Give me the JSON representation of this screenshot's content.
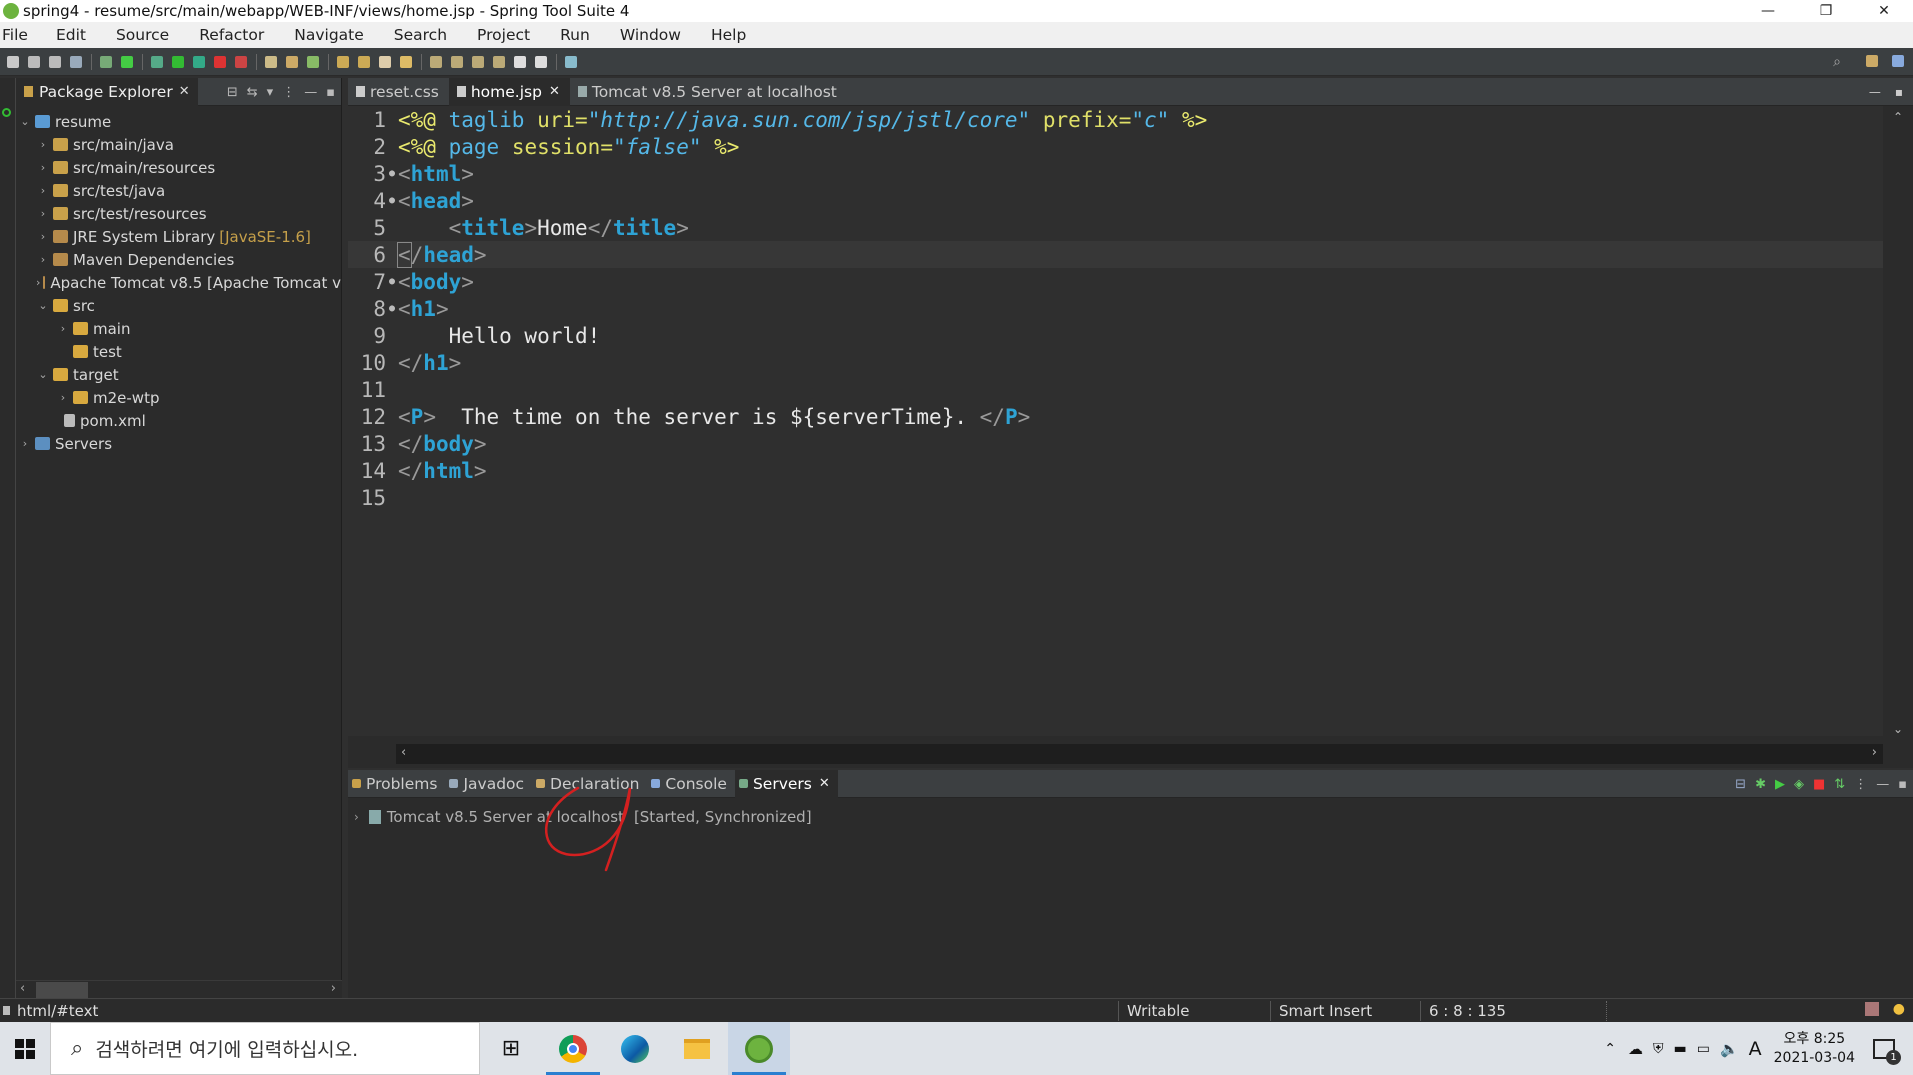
{
  "window": {
    "title": "spring4 - resume/src/main/webapp/WEB-INF/views/home.jsp - Spring Tool Suite 4",
    "minimize_glyph": "—",
    "restore_glyph": "❐",
    "close_glyph": "✕"
  },
  "menu": [
    "File",
    "Edit",
    "Source",
    "Refactor",
    "Navigate",
    "Search",
    "Project",
    "Run",
    "Window",
    "Help"
  ],
  "package_explorer": {
    "title": "Package Explorer",
    "tree": [
      {
        "label": "resume",
        "icon": "project-icon",
        "expanded": true
      },
      {
        "label": "src/main/java",
        "icon": "package-folder-icon"
      },
      {
        "label": "src/main/resources",
        "icon": "package-folder-icon"
      },
      {
        "label": "src/test/java",
        "icon": "package-folder-icon"
      },
      {
        "label": "src/test/resources",
        "icon": "package-folder-icon"
      },
      {
        "label": "JRE System Library",
        "decoration": "[JavaSE-1.6]",
        "icon": "library-icon"
      },
      {
        "label": "Maven Dependencies",
        "icon": "library-icon"
      },
      {
        "label": "Apache Tomcat v8.5 [Apache Tomcat v",
        "icon": "library-icon"
      },
      {
        "label": "src",
        "icon": "folder-icon",
        "expanded": true
      },
      {
        "label": "main",
        "icon": "folder-icon"
      },
      {
        "label": "test",
        "icon": "folder-icon"
      },
      {
        "label": "target",
        "icon": "folder-icon",
        "expanded": true
      },
      {
        "label": "m2e-wtp",
        "icon": "folder-icon"
      },
      {
        "label": "pom.xml",
        "icon": "file-icon"
      },
      {
        "label": "Servers",
        "icon": "server-folder-icon"
      }
    ]
  },
  "editor": {
    "tabs": [
      {
        "label": "reset.css",
        "active": false
      },
      {
        "label": "home.jsp",
        "active": true
      },
      {
        "label": "Tomcat v8.5 Server at localhost",
        "active": false
      }
    ],
    "current_line": 6,
    "lines": [
      {
        "n": "1"
      },
      {
        "n": "2"
      },
      {
        "n": "3"
      },
      {
        "n": "4"
      },
      {
        "n": "5"
      },
      {
        "n": "6"
      },
      {
        "n": "7"
      },
      {
        "n": "8"
      },
      {
        "n": "9"
      },
      {
        "n": "10"
      },
      {
        "n": "11"
      },
      {
        "n": "12"
      },
      {
        "n": "13"
      },
      {
        "n": "14"
      },
      {
        "n": "15"
      }
    ],
    "code": {
      "l1_open": "<%@",
      "l1_dir": "taglib",
      "l1_attr1": "uri=",
      "l1_val1": "\"http://java.sun.com/jsp/jstl/core\"",
      "l1_attr2": "prefix=",
      "l1_val2": "\"c\"",
      "l1_close": "%>",
      "l2_open": "<%@",
      "l2_dir": "page",
      "l2_attr": "session=",
      "l2_val": "\"false\"",
      "l2_close": "%>",
      "tag_html": "html",
      "tag_head": "head",
      "tag_title": "title",
      "title_text": "Home",
      "tag_body": "body",
      "tag_h1": "h1",
      "h1_text": "Hello world!",
      "tag_p": "P",
      "p_text": "The time on the server is ${serverTime}. "
    }
  },
  "bottom_panel": {
    "tabs": [
      {
        "label": "Problems",
        "active": false
      },
      {
        "label": "Javadoc",
        "active": false
      },
      {
        "label": "Declaration",
        "active": false
      },
      {
        "label": "Console",
        "active": false
      },
      {
        "label": "Servers",
        "active": true
      }
    ],
    "server": {
      "name": "Tomcat v8.5 Server at localhost",
      "state": "[Started, Synchronized]"
    }
  },
  "status_bar": {
    "path": "html/#text",
    "writable": "Writable",
    "insert_mode": "Smart Insert",
    "position": "6 : 8 : 135"
  },
  "taskbar": {
    "search_placeholder": "검색하려면 여기에 입력하십시오.",
    "ime": "A",
    "clock_time": "오후 8:25",
    "clock_date": "2021-03-04",
    "notification_count": "1"
  },
  "colors": {
    "tag": "#2ea3d5",
    "jsp_delim": "#eaea6e",
    "string": "#55b8e8",
    "annotation_circle": "#d42020"
  }
}
